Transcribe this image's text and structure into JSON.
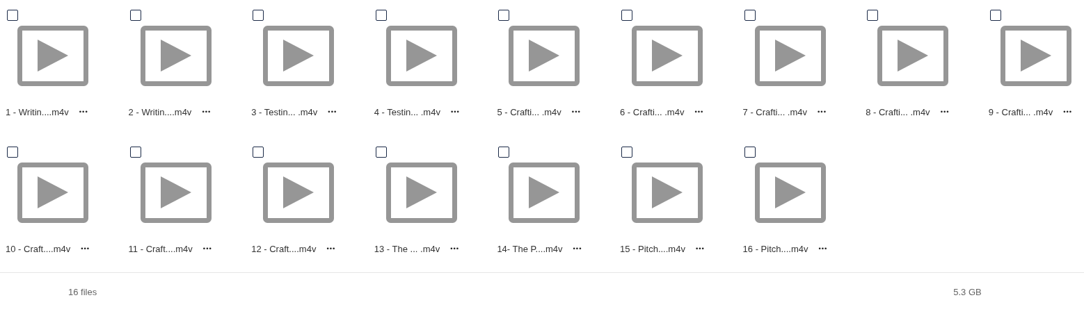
{
  "files": [
    {
      "label": "1 - Writin....m4v",
      "checked": false
    },
    {
      "label": "2 - Writin....m4v",
      "checked": false
    },
    {
      "label": "3 - Testin... .m4v",
      "checked": false
    },
    {
      "label": "4 - Testin... .m4v",
      "checked": false
    },
    {
      "label": "5 - Crafti... .m4v",
      "checked": false
    },
    {
      "label": "6 - Crafti... .m4v",
      "checked": false
    },
    {
      "label": "7 - Crafti... .m4v",
      "checked": false
    },
    {
      "label": "8 - Crafti... .m4v",
      "checked": false
    },
    {
      "label": "9 - Crafti... .m4v",
      "checked": false
    },
    {
      "label": "10 - Craft....m4v",
      "checked": false
    },
    {
      "label": "11 - Craft....m4v",
      "checked": false
    },
    {
      "label": "12 - Craft....m4v",
      "checked": false
    },
    {
      "label": "13 - The ... .m4v",
      "checked": false
    },
    {
      "label": "14- The P....m4v",
      "checked": false
    },
    {
      "label": "15 - Pitch....m4v",
      "checked": false
    },
    {
      "label": "16 - Pitch....m4v",
      "checked": false
    }
  ],
  "more_glyph": "•••",
  "footer": {
    "count": "16 files",
    "size": "5.3 GB"
  }
}
